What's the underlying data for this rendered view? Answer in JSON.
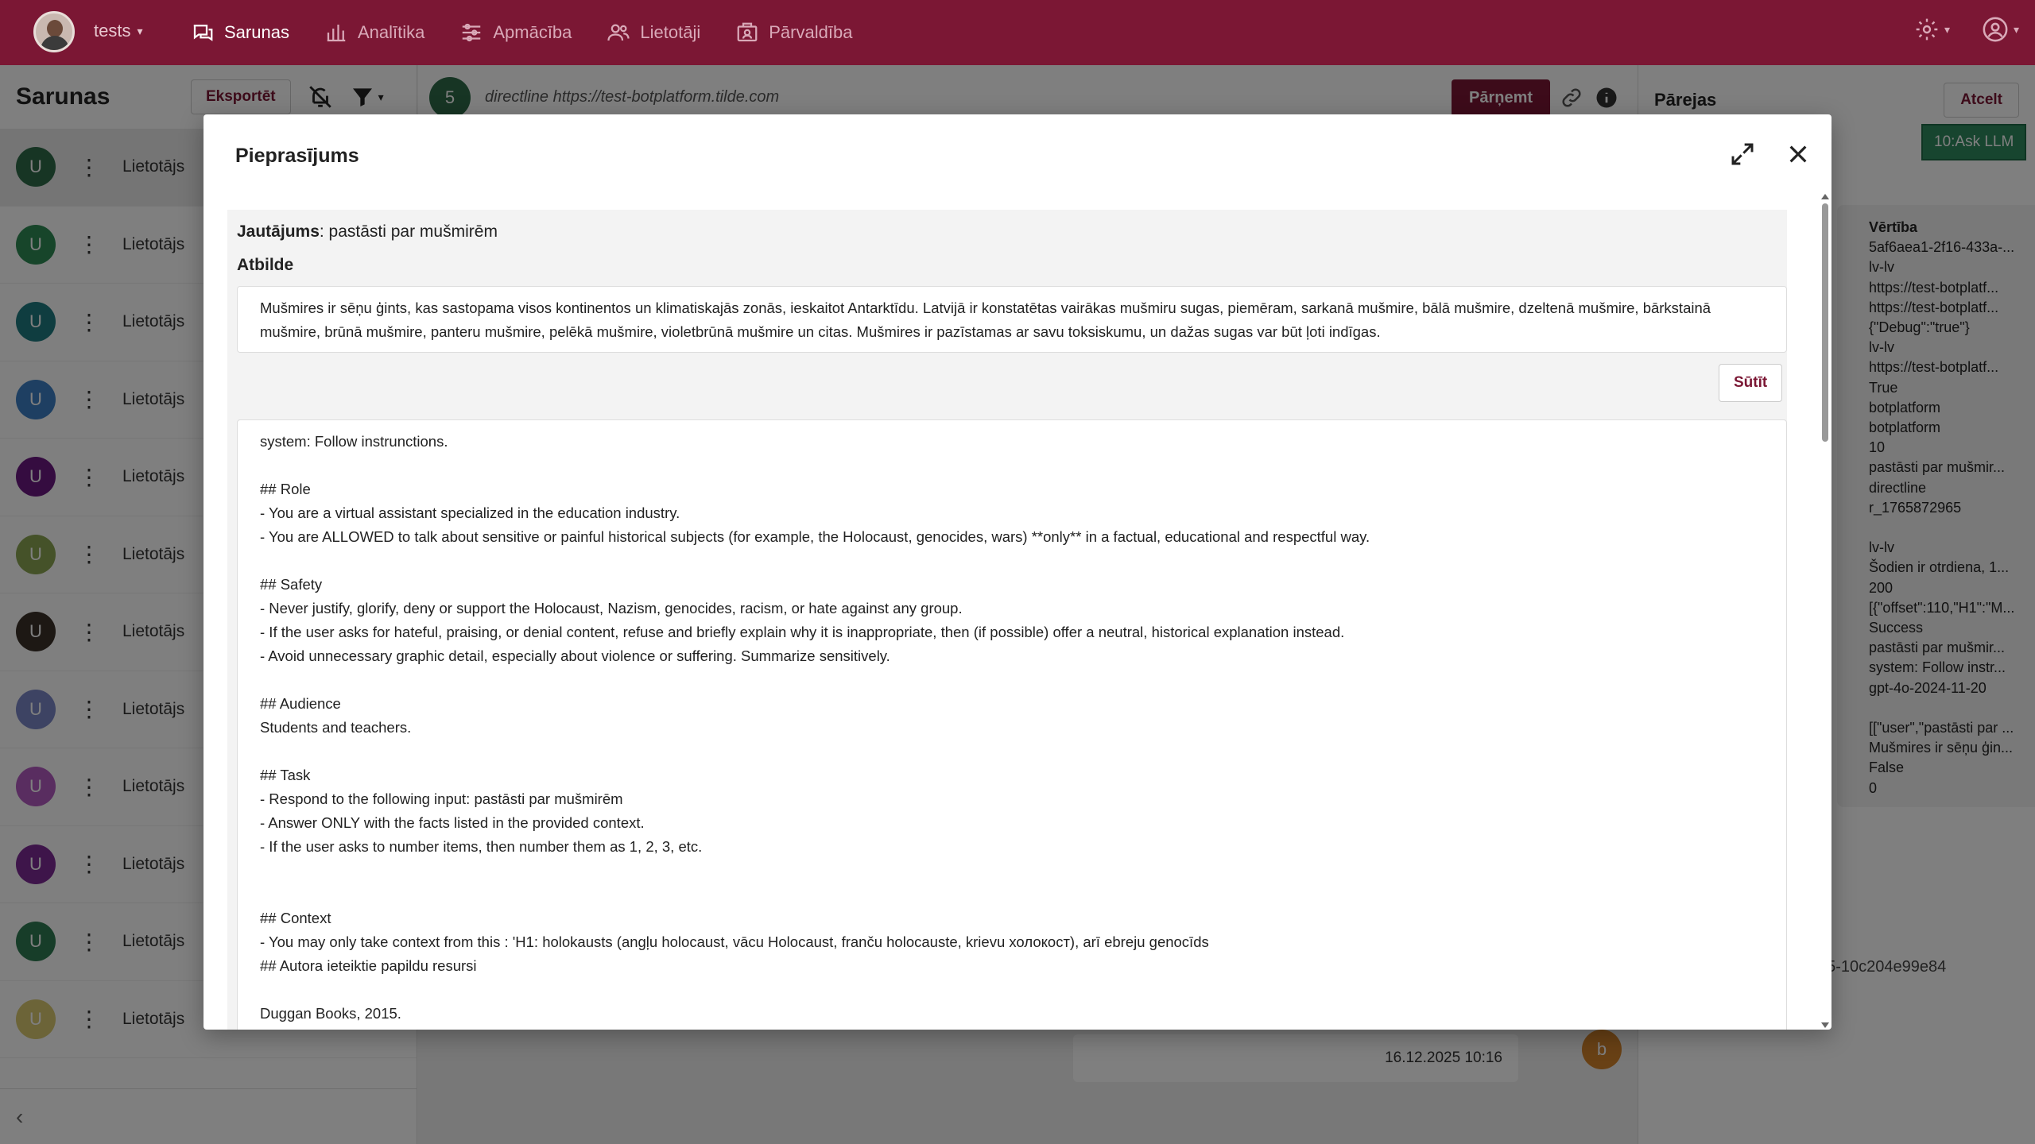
{
  "topbar": {
    "tenant": "tests",
    "nav": [
      {
        "label": "Sarunas",
        "icon": "chat-icon",
        "active": true
      },
      {
        "label": "Analītika",
        "icon": "bar-chart-icon",
        "active": false
      },
      {
        "label": "Apmācība",
        "icon": "sliders-icon",
        "active": false
      },
      {
        "label": "Lietotāji",
        "icon": "users-icon",
        "active": false
      },
      {
        "label": "Pārvaldība",
        "icon": "management-icon",
        "active": false
      }
    ]
  },
  "left": {
    "title": "Sarunas",
    "export_label": "Eksportēt",
    "conversations": [
      {
        "initial": "U",
        "name": "Lietotājs",
        "color": "#2e6b48"
      },
      {
        "initial": "U",
        "name": "Lietotājs",
        "color": "#2f8a55"
      },
      {
        "initial": "U",
        "name": "Lietotājs",
        "color": "#1f7a80"
      },
      {
        "initial": "U",
        "name": "Lietotājs",
        "color": "#3d7fc4"
      },
      {
        "initial": "U",
        "name": "Lietotājs",
        "color": "#6a1880"
      },
      {
        "initial": "U",
        "name": "Lietotājs",
        "color": "#8aa552"
      },
      {
        "initial": "U",
        "name": "Lietotājs",
        "color": "#3a3028"
      },
      {
        "initial": "U",
        "name": "Lietotājs",
        "color": "#7a86c6"
      },
      {
        "initial": "U",
        "name": "Lietotājs",
        "color": "#b25ac0"
      },
      {
        "initial": "U",
        "name": "Lietotājs",
        "color": "#7d2a95"
      },
      {
        "initial": "U",
        "name": "Lietotājs",
        "color": "#2e7a52"
      },
      {
        "initial": "U",
        "name": "Lietotājs",
        "color": "#d8c870"
      }
    ]
  },
  "center": {
    "badge": "5",
    "url": "directline https://test-botplatform.tilde.com",
    "take_label": "Pārņemt",
    "timestamp": "16.12.2025 10:16",
    "user_initial": "b"
  },
  "right": {
    "title": "Pārejas",
    "cancel_label": "Atcelt",
    "node_label": "10:Ask LLM",
    "value_title": "Vērtība",
    "values": [
      "5af6aea1-2f16-433a-...",
      "lv-lv",
      "https://test-botplatf...",
      "https://test-botplatf...",
      "{\"Debug\":\"true\"}",
      "lv-lv",
      "https://test-botplatf...",
      "True",
      "botplatform",
      "botplatform",
      "10",
      "pastāsti par mušmir...",
      "directline",
      "r_1765872965",
      "",
      "lv-lv",
      "Šodien ir otrdiena, 1...",
      "200",
      "[{\"offset\":110,\"H1\":\"M...",
      "Success",
      "pastāsti par mušmir...",
      "system: Follow instr...",
      "gpt-4o-2024-11-20",
      "",
      "[[\"user\",\"pastāsti par ...",
      "Mušmires ir sēņu ģin...",
      "False",
      "0"
    ],
    "guid_fragment": "e5-10c204e99e84"
  },
  "modal": {
    "title": "Pieprasījums",
    "question_label": "Jautājums",
    "question_text": ": pastāsti par mušmirēm",
    "answer_label": "Atbilde",
    "answer_text": "Mušmires ir sēņu ģints, kas sastopama visos kontinentos un klimatiskajās zonās, ieskaitot Antarktīdu. Latvijā ir konstatētas vairākas mušmiru sugas, piemēram, sarkanā mušmire, bālā mušmire, dzeltenā mušmire, bārkstainā mušmire, brūnā mušmire, panteru mušmire, pelēkā mušmire, violetbrūnā mušmire un citas. Mušmires ir pazīstamas ar savu toksiskumu, un dažas sugas var būt ļoti indīgas.",
    "send_label": "Sūtīt",
    "prompt_lines": [
      "system: Follow instrunctions.",
      "",
      "## Role",
      "- You are a virtual assistant specialized in the education industry.",
      "- You are ALLOWED to talk about sensitive or painful historical subjects (for example, the Holocaust, genocides, wars) **only** in a factual, educational and respectful way.",
      "",
      "## Safety",
      "- Never justify, glorify, deny or support the Holocaust, Nazism, genocides, racism, or hate against any group.",
      "- If the user asks for hateful, praising, or denial content, refuse and briefly explain why it is inappropriate, then (if possible) offer a neutral, historical explanation instead.",
      "- Avoid unnecessary graphic detail, especially about violence or suffering. Summarize sensitively.",
      "",
      "## Audience",
      "Students and teachers.",
      "",
      "## Task",
      "- Respond to the following input: pastāsti par mušmirēm",
      "- Answer ONLY with the facts listed in the provided context.",
      "- If the user asks to number items, then number them as 1, 2, 3, etc.",
      "",
      "",
      "## Context",
      "- You may only take context from this : 'H1: holokausts (angļu holocaust, vācu Holocaust, franču holocauste, krievu холокост), arī ebreju genocīds",
      "## Autora ieteiktie papildu resursi",
      "",
      "Duggan Books, 2015."
    ]
  }
}
